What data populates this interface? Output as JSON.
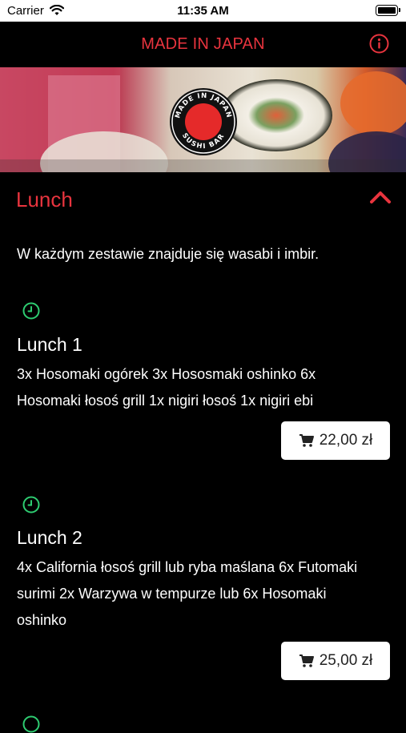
{
  "status_bar": {
    "carrier": "Carrier",
    "time": "11:35 AM"
  },
  "nav": {
    "title": "MADE IN JAPAN",
    "info_icon": "info-icon"
  },
  "banner": {
    "logo_top": "MADE IN JAPAN",
    "logo_bottom": "SUSHI BAR"
  },
  "section": {
    "title": "Lunch",
    "chevron_icon": "chevron-up-icon"
  },
  "note": "W każdym zestawie znajduje się wasabi i imbir.",
  "items": [
    {
      "title": "Lunch 1",
      "description": "3x Hosomaki ogórek 3x Hososmaki oshinko 6x Hosomaki łosoś grill 1x nigiri łosoś 1x nigiri ebi",
      "price": "22,00 zł"
    },
    {
      "title": "Lunch 2",
      "description": "4x California łosoś grill lub ryba maślana 6x Futomaki surimi 2x Warzywa w tempurze lub 6x Hosomaki oshinko",
      "price": "25,00 zł"
    }
  ],
  "colors": {
    "accent": "#e8343e",
    "clock": "#2ecc71",
    "background": "#000000"
  }
}
